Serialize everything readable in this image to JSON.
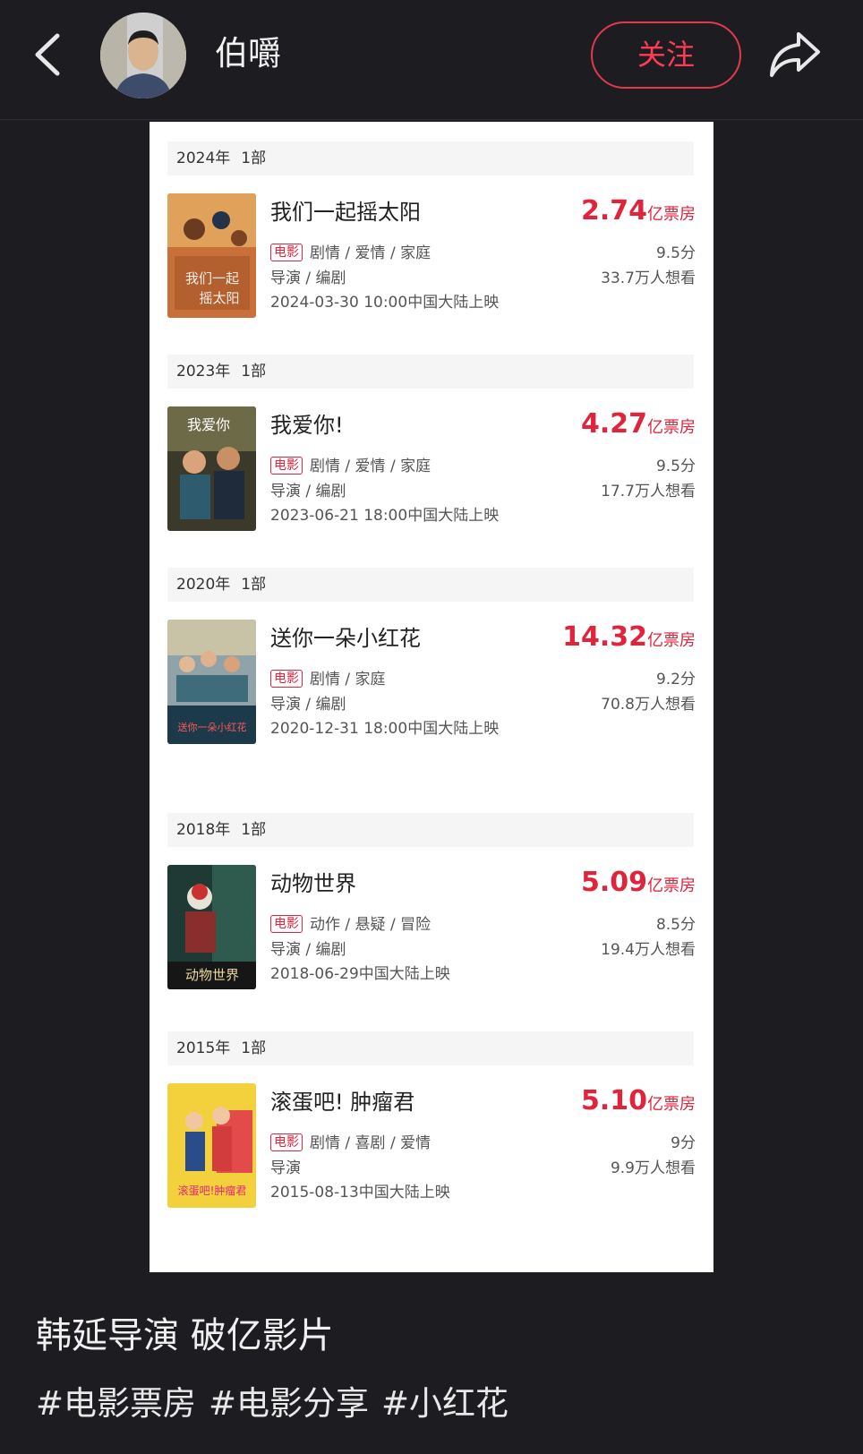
{
  "header": {
    "username": "伯嚼",
    "follow_label": "关注"
  },
  "films": [
    {
      "year": "2024年",
      "count": "1部",
      "title": "我们一起摇太阳",
      "box_value": "2.74",
      "box_unit": "亿票房",
      "tag": "电影",
      "genres": "剧情 / 爱情 / 家庭",
      "rating": "9.5分",
      "role": "导演 / 编剧",
      "want": "33.7万人想看",
      "release": "2024-03-30 10:00中国大陆上映",
      "poster_text": "我们一起摇太阳"
    },
    {
      "year": "2023年",
      "count": "1部",
      "title": "我爱你!",
      "box_value": "4.27",
      "box_unit": "亿票房",
      "tag": "电影",
      "genres": "剧情 / 爱情 / 家庭",
      "rating": "9.5分",
      "role": "导演 / 编剧",
      "want": "17.7万人想看",
      "release": "2023-06-21 18:00中国大陆上映",
      "poster_text": "我爱你"
    },
    {
      "year": "2020年",
      "count": "1部",
      "title": "送你一朵小红花",
      "box_value": "14.32",
      "box_unit": "亿票房",
      "tag": "电影",
      "genres": "剧情 / 家庭",
      "rating": "9.2分",
      "role": "导演 / 编剧",
      "want": "70.8万人想看",
      "release": "2020-12-31 18:00中国大陆上映",
      "poster_text": "送你一朵小红花"
    },
    {
      "year": "2018年",
      "count": "1部",
      "title": "动物世界",
      "box_value": "5.09",
      "box_unit": "亿票房",
      "tag": "电影",
      "genres": "动作 / 悬疑 / 冒险",
      "rating": "8.5分",
      "role": "导演 / 编剧",
      "want": "19.4万人想看",
      "release": "2018-06-29中国大陆上映",
      "poster_text": "动物世界"
    },
    {
      "year": "2015年",
      "count": "1部",
      "title": "滚蛋吧! 肿瘤君",
      "box_value": "5.10",
      "box_unit": "亿票房",
      "tag": "电影",
      "genres": "剧情 / 喜剧 / 爱情",
      "rating": "9分",
      "role": "导演",
      "want": "9.9万人想看",
      "release": "2015-08-13中国大陆上映",
      "poster_text": "滚蛋吧!肿瘤君"
    }
  ],
  "post": {
    "caption": "韩延导演 破亿影片",
    "hashtags": [
      "#电影票房",
      "#电影分享",
      "#小红花"
    ]
  },
  "colors": {
    "background": "#1c1c21",
    "accent": "#e0243b",
    "card": "#ffffff"
  }
}
